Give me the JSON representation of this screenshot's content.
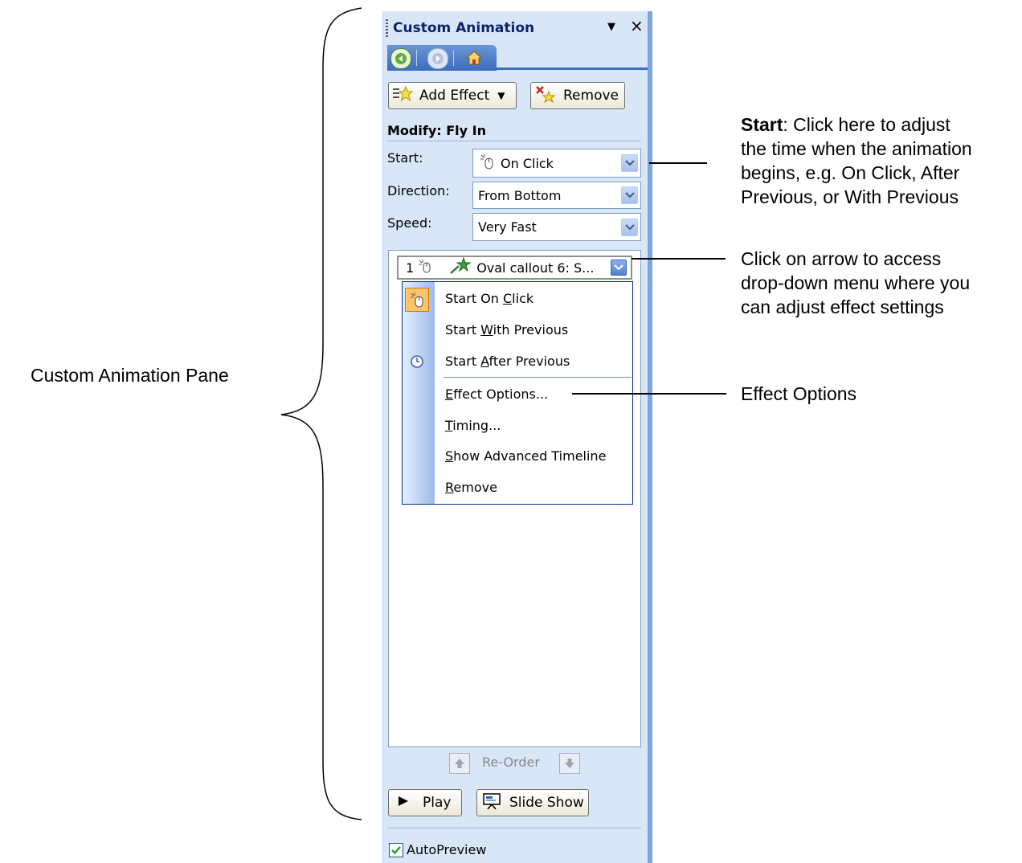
{
  "pane": {
    "title": "Custom Animation",
    "menu_glyph": "▼",
    "close_glyph": "×"
  },
  "toolbar": {
    "add_effect_label": "Add Effect",
    "remove_label": "Remove"
  },
  "modify": {
    "header": "Modify: Fly In",
    "start_label": "Start:",
    "start_value": "On Click",
    "direction_label": "Direction:",
    "direction_value": "From Bottom",
    "speed_label": "Speed:",
    "speed_value": "Very Fast"
  },
  "effect_list": {
    "item_number": "1",
    "item_label": "Oval callout 6: S..."
  },
  "context_menu": {
    "start_on_click": {
      "pre": "Start On ",
      "key": "C",
      "post": "lick"
    },
    "start_with_previous": {
      "pre": "Start ",
      "key": "W",
      "post": "ith Previous"
    },
    "start_after_previous": {
      "pre": "Start ",
      "key": "A",
      "post": "fter Previous"
    },
    "effect_options": {
      "pre": "",
      "key": "E",
      "post": "ffect Options..."
    },
    "timing": {
      "pre": "",
      "key": "T",
      "post": "iming..."
    },
    "show_advanced_timeline": {
      "pre": "",
      "key": "S",
      "post": "how Advanced Timeline"
    },
    "remove": {
      "pre": "",
      "key": "R",
      "post": "emove"
    }
  },
  "reorder_label": "Re-Order",
  "footer": {
    "play_label": "Play",
    "slideshow_label": "Slide Show",
    "autopreview_label": "AutoPreview",
    "autopreview_checked": true
  },
  "annotations": {
    "pane_label": "Custom Animation Pane",
    "start_bold": "Start",
    "start_text_1": ": Click here to adjust",
    "start_text_2": "the time when the animation",
    "start_text_3": "begins, e.g. On Click, After",
    "start_text_4": "Previous, or With Previous",
    "arrow_text_1": "Click on arrow to access",
    "arrow_text_2": "drop-down menu where you",
    "arrow_text_3": "can adjust effect settings",
    "effect_options_text": "Effect Options"
  },
  "colors": {
    "pane_bg": "#d8e6f8",
    "menu_border": "#002d96",
    "title_color": "#0a246a"
  }
}
